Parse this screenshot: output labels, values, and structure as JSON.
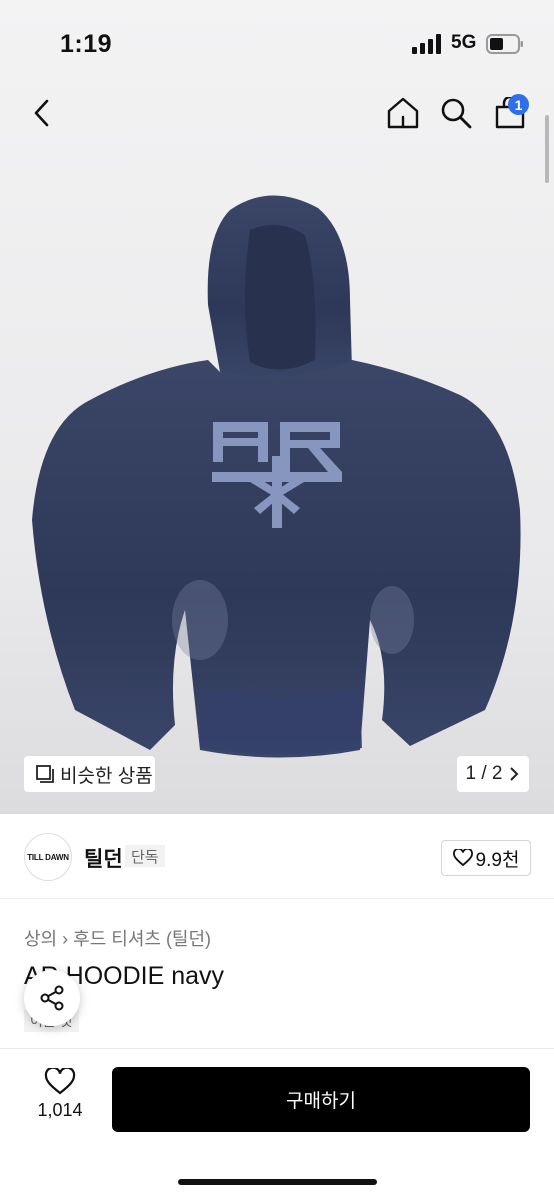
{
  "status": {
    "time": "1:19",
    "network": "5G"
  },
  "nav": {
    "cart_count": "1"
  },
  "gallery": {
    "similar_label": "비슷한 상품",
    "pager": "1 / 2",
    "print_text": "AR"
  },
  "brand": {
    "logo_text": "TILL DAWN",
    "name": "틸던",
    "exclusive": "단독",
    "likes": "9.9천"
  },
  "product": {
    "breadcrumb_1": "상의",
    "breadcrumb_2": "후드 티셔츠 (틸던)",
    "title": "AR HOODIE navy",
    "tag": "이른 것"
  },
  "bottom": {
    "wish_count": "1,014",
    "buy_label": "구매하기"
  },
  "colors": {
    "accent": "#2f6fe9",
    "hoodie": "#2f3a5c",
    "print": "#8796bf"
  },
  "icons": [
    "back-arrow-icon",
    "home-icon",
    "search-icon",
    "cart-icon",
    "similar-icon",
    "chevron-right-icon",
    "heart-icon",
    "share-icon"
  ]
}
